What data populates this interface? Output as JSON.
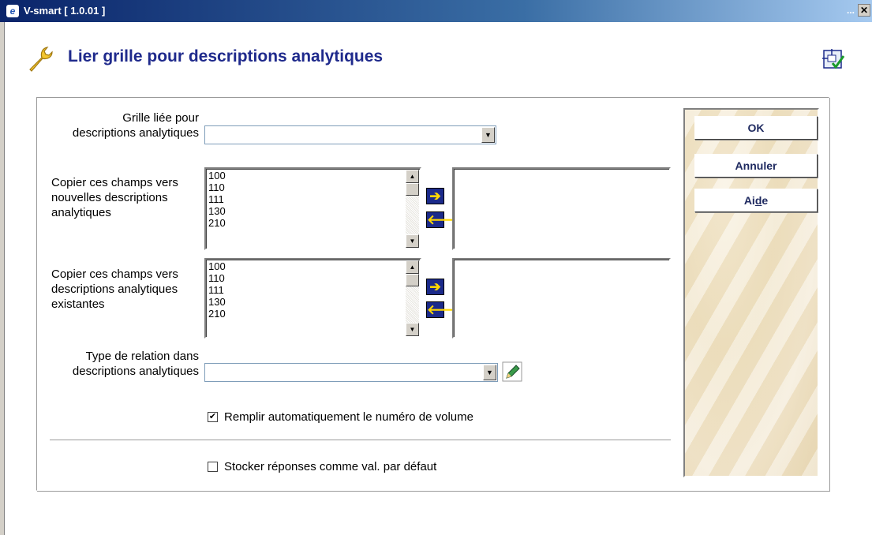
{
  "window": {
    "title": "V-smart [ 1.0.01 ]",
    "app_icon_glyph": "e",
    "dots": "...",
    "close_glyph": "✕"
  },
  "header": {
    "title": "Lier grille pour descriptions analytiques",
    "left_icon": "wrench-icon",
    "right_icon": "form-check-icon"
  },
  "form": {
    "grille_label": "Grille liée pour descriptions analytiques",
    "grille_value": "",
    "copy_new_label": "Copier ces champs vers nouvelles descriptions analytiques",
    "copy_new_items": [
      "100",
      "110",
      "111",
      "130",
      "210"
    ],
    "copy_existing_label": "Copier ces champs vers descriptions analytiques existantes",
    "copy_existing_items": [
      "100",
      "110",
      "111",
      "130",
      "210"
    ],
    "relation_label": "Type de relation dans descriptions analytiques",
    "relation_value": "",
    "auto_volume_label": "Remplir automatiquement le numéro de volume",
    "auto_volume_checked": true,
    "store_defaults_label": "Stocker réponses comme val. par défaut",
    "store_defaults_checked": false
  },
  "buttons": {
    "ok": "OK",
    "cancel": "Annuler",
    "help_pre": "Ai",
    "help_mnemonic": "d",
    "help_post": "e"
  },
  "glyphs": {
    "arrow_right": "➔",
    "arrow_left": "🡐",
    "scroll_up": "▲",
    "scroll_down": "▼",
    "dropdown": "▼",
    "check": "✔"
  },
  "colors": {
    "title_blue": "#1f2a8c",
    "arrow_btn_bg": "#1b2a8a",
    "arrow_glyph": "#ffd700"
  }
}
